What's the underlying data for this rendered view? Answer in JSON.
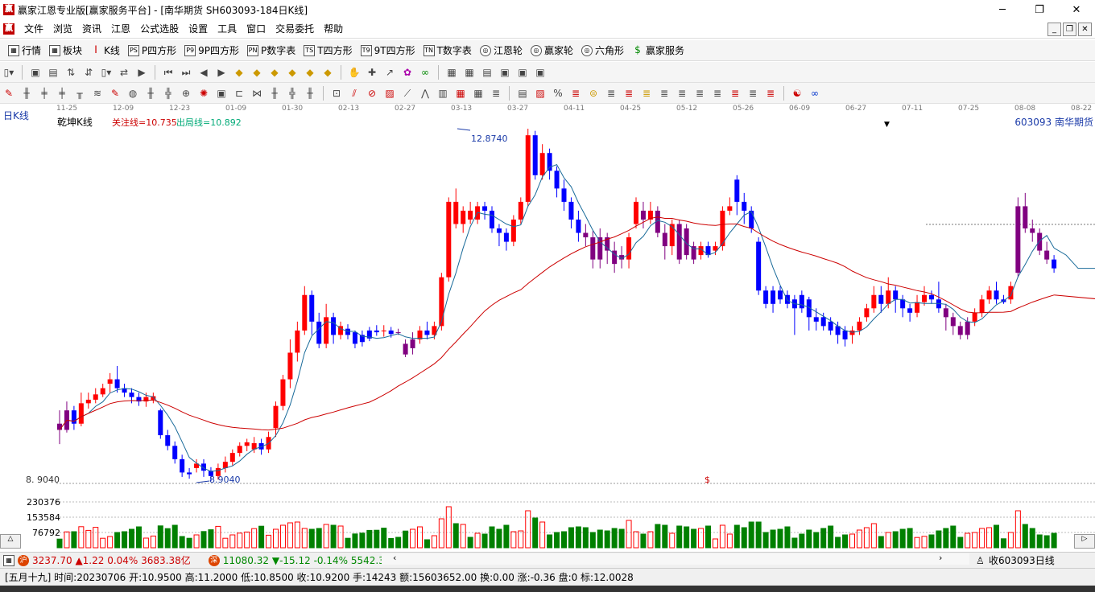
{
  "window": {
    "title": "赢家江恩专业版[赢家服务平台] - [南华期货   SH603093-184日K线]",
    "logo_char": "赢",
    "min": "─",
    "max": "❐",
    "close": "✕"
  },
  "menu": {
    "items": [
      "文件",
      "浏览",
      "资讯",
      "江恩",
      "公式选股",
      "设置",
      "工具",
      "窗口",
      "交易委托",
      "帮助"
    ]
  },
  "toolbar1": {
    "items": [
      {
        "icon": "▦",
        "label": "行情"
      },
      {
        "icon": "▦",
        "label": "板块"
      },
      {
        "icon": "┃",
        "label": "K线"
      },
      {
        "icon": "PS",
        "label": "P四方形"
      },
      {
        "icon": "P9",
        "label": "9P四方形"
      },
      {
        "icon": "PN",
        "label": "P数字表"
      },
      {
        "icon": "TS",
        "label": "T四方形"
      },
      {
        "icon": "T9",
        "label": "9T四方形"
      },
      {
        "icon": "TN",
        "label": "T数字表"
      },
      {
        "icon": "◎",
        "label": "江恩轮"
      },
      {
        "icon": "◎",
        "label": "赢家轮"
      },
      {
        "icon": "◎",
        "label": "六角形"
      },
      {
        "icon": "$",
        "label": "赢家服务"
      }
    ]
  },
  "chart": {
    "period_label": "日K线",
    "indicator_name": "乾坤K线",
    "focus_line": "关注线=10.735",
    "exit_line": "出局线=10.892",
    "stock": "603093  南华期货",
    "high_label": "12.8740",
    "low_label": "8.9040",
    "low_axis": "8. 9040",
    "dollar": "$",
    "dates": [
      "11-25",
      "12-09",
      "12-23",
      "01-09",
      "01-30",
      "02-13",
      "02-27",
      "03-13",
      "03-27",
      "04-11",
      "04-25",
      "05-12",
      "05-26",
      "06-09",
      "06-27",
      "07-11",
      "07-25",
      "08-08",
      "08-22"
    ],
    "vol_ticks": [
      "230376",
      "153584",
      "76792"
    ]
  },
  "colors": {
    "up": "#ff0000",
    "down": "#0000ff",
    "neutral": "#800080",
    "ma_short": "#1a6b9a",
    "ma_long": "#cc0000",
    "vol_up": "#ff0000",
    "vol_down": "#008000"
  },
  "chart_data": {
    "type": "candlestick",
    "y_range": [
      8.904,
      12.874
    ],
    "candles": [
      {
        "o": 9.55,
        "c": 9.48,
        "h": 9.7,
        "l": 9.32
      },
      {
        "o": 9.48,
        "c": 9.7,
        "h": 9.8,
        "l": 9.45
      },
      {
        "o": 9.7,
        "c": 9.55,
        "h": 9.75,
        "l": 9.48
      },
      {
        "o": 9.55,
        "c": 9.78,
        "h": 9.9,
        "l": 9.52
      },
      {
        "o": 9.78,
        "c": 9.82,
        "h": 9.9,
        "l": 9.72
      },
      {
        "o": 9.82,
        "c": 9.88,
        "h": 9.95,
        "l": 9.78
      },
      {
        "o": 9.88,
        "c": 9.95,
        "h": 10.0,
        "l": 9.85
      },
      {
        "o": 10.0,
        "c": 10.05,
        "h": 10.12,
        "l": 9.9
      },
      {
        "o": 10.05,
        "c": 9.95,
        "h": 10.2,
        "l": 9.9
      },
      {
        "o": 9.95,
        "c": 9.9,
        "h": 10.0,
        "l": 9.85
      },
      {
        "o": 9.9,
        "c": 9.85,
        "h": 9.95,
        "l": 9.78
      },
      {
        "o": 9.85,
        "c": 9.8,
        "h": 9.9,
        "l": 9.75
      },
      {
        "o": 9.8,
        "c": 9.85,
        "h": 9.9,
        "l": 9.74
      },
      {
        "o": 9.82,
        "c": 9.86,
        "h": 9.9,
        "l": 9.78
      },
      {
        "o": 9.7,
        "c": 9.42,
        "h": 9.72,
        "l": 9.38
      },
      {
        "o": 9.42,
        "c": 9.3,
        "h": 9.48,
        "l": 9.25
      },
      {
        "o": 9.3,
        "c": 9.15,
        "h": 9.35,
        "l": 9.1
      },
      {
        "o": 9.15,
        "c": 9.0,
        "h": 9.2,
        "l": 8.95
      },
      {
        "o": 9.0,
        "c": 8.98,
        "h": 9.05,
        "l": 8.93
      },
      {
        "o": 9.05,
        "c": 9.1,
        "h": 9.15,
        "l": 9.0
      },
      {
        "o": 9.1,
        "c": 9.02,
        "h": 9.15,
        "l": 8.95
      },
      {
        "o": 9.02,
        "c": 8.96,
        "h": 9.06,
        "l": 8.904
      },
      {
        "o": 8.96,
        "c": 9.05,
        "h": 9.1,
        "l": 8.92
      },
      {
        "o": 9.05,
        "c": 9.12,
        "h": 9.18,
        "l": 9.0
      },
      {
        "o": 9.12,
        "c": 9.22,
        "h": 9.26,
        "l": 9.08
      },
      {
        "o": 9.22,
        "c": 9.3,
        "h": 9.34,
        "l": 9.18
      },
      {
        "o": 9.3,
        "c": 9.34,
        "h": 9.38,
        "l": 9.24
      },
      {
        "o": 9.26,
        "c": 9.33,
        "h": 9.4,
        "l": 9.22
      },
      {
        "o": 9.33,
        "c": 9.26,
        "h": 9.38,
        "l": 9.2
      },
      {
        "o": 9.26,
        "c": 9.4,
        "h": 9.46,
        "l": 9.22
      },
      {
        "o": 9.5,
        "c": 9.75,
        "h": 9.8,
        "l": 9.4
      },
      {
        "o": 9.75,
        "c": 10.05,
        "h": 10.1,
        "l": 9.7
      },
      {
        "o": 10.05,
        "c": 10.35,
        "h": 10.5,
        "l": 9.95
      },
      {
        "o": 10.35,
        "c": 10.6,
        "h": 10.7,
        "l": 10.25
      },
      {
        "o": 10.6,
        "c": 11.0,
        "h": 11.1,
        "l": 10.55
      },
      {
        "o": 11.0,
        "c": 10.7,
        "h": 11.05,
        "l": 10.55
      },
      {
        "o": 10.7,
        "c": 10.45,
        "h": 10.8,
        "l": 10.4
      },
      {
        "o": 10.45,
        "c": 10.75,
        "h": 10.9,
        "l": 10.4
      },
      {
        "o": 10.75,
        "c": 10.55,
        "h": 10.8,
        "l": 10.45
      },
      {
        "o": 10.55,
        "c": 10.65,
        "h": 10.7,
        "l": 10.5
      },
      {
        "o": 10.62,
        "c": 10.55,
        "h": 10.67,
        "l": 10.5
      },
      {
        "o": 10.58,
        "c": 10.45,
        "h": 10.6,
        "l": 10.4
      },
      {
        "o": 10.55,
        "c": 10.47,
        "h": 10.6,
        "l": 10.42
      },
      {
        "o": 10.6,
        "c": 10.51,
        "h": 10.64,
        "l": 10.48
      },
      {
        "o": 10.6,
        "c": 10.58,
        "h": 10.66,
        "l": 10.54
      },
      {
        "o": 10.6,
        "c": 10.59,
        "h": 10.66,
        "l": 10.53
      },
      {
        "o": 10.6,
        "c": 10.56,
        "h": 10.64,
        "l": 10.52
      },
      {
        "o": 10.58,
        "c": 10.58,
        "h": 10.62,
        "l": 10.55
      },
      {
        "o": 10.45,
        "c": 10.33,
        "h": 10.5,
        "l": 10.3
      },
      {
        "o": 10.4,
        "c": 10.5,
        "h": 10.58,
        "l": 10.33
      },
      {
        "o": 10.5,
        "c": 10.6,
        "h": 10.65,
        "l": 10.45
      },
      {
        "o": 10.6,
        "c": 10.55,
        "h": 10.7,
        "l": 10.5
      },
      {
        "o": 10.55,
        "c": 10.65,
        "h": 10.7,
        "l": 10.5
      },
      {
        "o": 10.65,
        "c": 11.2,
        "h": 11.25,
        "l": 10.6
      },
      {
        "o": 11.2,
        "c": 12.05,
        "h": 12.1,
        "l": 11.15
      },
      {
        "o": 12.05,
        "c": 11.8,
        "h": 12.2,
        "l": 11.75
      },
      {
        "o": 11.8,
        "c": 11.95,
        "h": 12.0,
        "l": 11.7
      },
      {
        "o": 11.95,
        "c": 11.85,
        "h": 12.05,
        "l": 11.8
      },
      {
        "o": 11.85,
        "c": 12.0,
        "h": 12.05,
        "l": 11.8
      },
      {
        "o": 12.0,
        "c": 11.95,
        "h": 12.05,
        "l": 11.85
      },
      {
        "o": 11.95,
        "c": 11.75,
        "h": 12.0,
        "l": 11.7
      },
      {
        "o": 11.75,
        "c": 11.7,
        "h": 11.8,
        "l": 11.55
      },
      {
        "o": 11.7,
        "c": 11.6,
        "h": 11.75,
        "l": 11.5
      },
      {
        "o": 11.6,
        "c": 11.85,
        "h": 11.9,
        "l": 11.55
      },
      {
        "o": 11.85,
        "c": 12.05,
        "h": 12.1,
        "l": 11.8
      },
      {
        "o": 12.05,
        "c": 12.8,
        "h": 12.874,
        "l": 12.0
      },
      {
        "o": 12.8,
        "c": 12.35,
        "h": 12.85,
        "l": 12.3
      },
      {
        "o": 12.35,
        "c": 12.6,
        "h": 12.7,
        "l": 12.3
      },
      {
        "o": 12.6,
        "c": 12.4,
        "h": 12.65,
        "l": 12.3
      },
      {
        "o": 12.4,
        "c": 12.2,
        "h": 12.45,
        "l": 12.1
      },
      {
        "o": 12.2,
        "c": 12.05,
        "h": 12.3,
        "l": 11.95
      },
      {
        "o": 12.05,
        "c": 11.85,
        "h": 12.1,
        "l": 11.75
      },
      {
        "o": 11.85,
        "c": 11.7,
        "h": 11.95,
        "l": 11.6
      },
      {
        "o": 11.7,
        "c": 11.65,
        "h": 11.8,
        "l": 11.55
      },
      {
        "o": 11.65,
        "c": 11.4,
        "h": 11.72,
        "l": 11.3
      },
      {
        "o": 11.65,
        "c": 11.4,
        "h": 11.75,
        "l": 11.3
      },
      {
        "o": 11.65,
        "c": 11.5,
        "h": 11.7,
        "l": 11.35
      },
      {
        "o": 11.5,
        "c": 11.35,
        "h": 11.6,
        "l": 11.25
      },
      {
        "o": 11.45,
        "c": 11.4,
        "h": 11.55,
        "l": 11.3
      },
      {
        "o": 11.4,
        "c": 11.65,
        "h": 11.7,
        "l": 11.3
      },
      {
        "o": 11.8,
        "c": 12.05,
        "h": 12.1,
        "l": 11.75
      },
      {
        "o": 11.95,
        "c": 11.85,
        "h": 12.05,
        "l": 11.75
      },
      {
        "o": 11.85,
        "c": 11.95,
        "h": 12.05,
        "l": 11.8
      },
      {
        "o": 11.95,
        "c": 11.7,
        "h": 12.0,
        "l": 11.65
      },
      {
        "o": 11.7,
        "c": 11.55,
        "h": 11.8,
        "l": 11.4
      },
      {
        "o": 11.55,
        "c": 11.8,
        "h": 11.85,
        "l": 11.45
      },
      {
        "o": 11.8,
        "c": 11.4,
        "h": 11.85,
        "l": 11.35
      },
      {
        "o": 11.75,
        "c": 11.45,
        "h": 11.8,
        "l": 11.4
      },
      {
        "o": 11.55,
        "c": 11.4,
        "h": 11.6,
        "l": 11.35
      },
      {
        "o": 11.45,
        "c": 11.55,
        "h": 11.6,
        "l": 11.4
      },
      {
        "o": 11.55,
        "c": 11.45,
        "h": 11.6,
        "l": 11.42
      },
      {
        "o": 11.5,
        "c": 11.55,
        "h": 11.6,
        "l": 11.45
      },
      {
        "o": 11.55,
        "c": 11.95,
        "h": 12.0,
        "l": 11.5
      },
      {
        "o": 11.95,
        "c": 12.0,
        "h": 12.1,
        "l": 11.9
      },
      {
        "o": 12.3,
        "c": 12.05,
        "h": 12.35,
        "l": 11.9
      },
      {
        "o": 12.05,
        "c": 11.95,
        "h": 12.15,
        "l": 11.8
      },
      {
        "o": 11.95,
        "c": 11.75,
        "h": 12.0,
        "l": 11.7
      },
      {
        "o": 11.6,
        "c": 11.05,
        "h": 11.65,
        "l": 11.0
      },
      {
        "o": 11.05,
        "c": 10.9,
        "h": 11.1,
        "l": 10.85
      },
      {
        "o": 11.05,
        "c": 10.9,
        "h": 11.1,
        "l": 10.8
      },
      {
        "o": 11.05,
        "c": 10.95,
        "h": 11.1,
        "l": 10.9
      },
      {
        "o": 11.0,
        "c": 10.9,
        "h": 11.05,
        "l": 10.85
      },
      {
        "o": 10.95,
        "c": 10.85,
        "h": 11.0,
        "l": 10.55
      },
      {
        "o": 11.0,
        "c": 10.85,
        "h": 11.05,
        "l": 10.8
      },
      {
        "o": 10.95,
        "c": 10.75,
        "h": 10.98,
        "l": 10.6
      },
      {
        "o": 10.75,
        "c": 10.7,
        "h": 10.85,
        "l": 10.6
      },
      {
        "o": 10.75,
        "c": 10.65,
        "h": 10.8,
        "l": 10.6
      },
      {
        "o": 10.7,
        "c": 10.6,
        "h": 10.75,
        "l": 10.55
      },
      {
        "o": 10.65,
        "c": 10.55,
        "h": 10.7,
        "l": 10.45
      },
      {
        "o": 10.6,
        "c": 10.5,
        "h": 10.65,
        "l": 10.42
      },
      {
        "o": 10.55,
        "c": 10.6,
        "h": 10.65,
        "l": 10.45
      },
      {
        "o": 10.6,
        "c": 10.7,
        "h": 10.75,
        "l": 10.55
      },
      {
        "o": 10.75,
        "c": 10.85,
        "h": 10.9,
        "l": 10.7
      },
      {
        "o": 10.85,
        "c": 11.0,
        "h": 11.1,
        "l": 10.8
      },
      {
        "o": 11.0,
        "c": 10.9,
        "h": 11.1,
        "l": 10.8
      },
      {
        "o": 10.9,
        "c": 11.05,
        "h": 11.2,
        "l": 10.85
      },
      {
        "o": 11.05,
        "c": 10.95,
        "h": 11.1,
        "l": 10.8
      },
      {
        "o": 10.95,
        "c": 10.85,
        "h": 11.0,
        "l": 10.75
      },
      {
        "o": 10.85,
        "c": 10.8,
        "h": 10.9,
        "l": 10.7
      },
      {
        "o": 10.8,
        "c": 10.92,
        "h": 11.0,
        "l": 10.75
      },
      {
        "o": 10.92,
        "c": 11.0,
        "h": 11.1,
        "l": 10.88
      },
      {
        "o": 11.0,
        "c": 10.95,
        "h": 11.05,
        "l": 10.9
      },
      {
        "o": 10.95,
        "c": 10.85,
        "h": 11.15,
        "l": 10.8
      },
      {
        "o": 10.85,
        "c": 10.75,
        "h": 10.9,
        "l": 10.6
      },
      {
        "o": 10.75,
        "c": 10.65,
        "h": 10.8,
        "l": 10.55
      },
      {
        "o": 10.65,
        "c": 10.55,
        "h": 10.7,
        "l": 10.5
      },
      {
        "o": 10.55,
        "c": 10.7,
        "h": 10.75,
        "l": 10.5
      },
      {
        "o": 10.7,
        "c": 10.8,
        "h": 10.85,
        "l": 10.65
      },
      {
        "o": 10.8,
        "c": 10.95,
        "h": 11.0,
        "l": 10.75
      },
      {
        "o": 10.95,
        "c": 11.05,
        "h": 11.1,
        "l": 10.9
      },
      {
        "o": 11.05,
        "c": 10.95,
        "h": 11.15,
        "l": 10.9
      },
      {
        "o": 10.95,
        "c": 10.92,
        "h": 11.0,
        "l": 10.9
      },
      {
        "o": 10.95,
        "c": 11.1,
        "h": 11.15,
        "l": 10.9
      },
      {
        "o": 11.25,
        "c": 12.0,
        "h": 12.1,
        "l": 11.2
      },
      {
        "o": 12.0,
        "c": 11.75,
        "h": 12.15,
        "l": 11.7
      },
      {
        "o": 11.75,
        "c": 11.7,
        "h": 11.85,
        "l": 11.6
      },
      {
        "o": 11.7,
        "c": 11.5,
        "h": 11.75,
        "l": 11.45
      },
      {
        "o": 11.5,
        "c": 11.4,
        "h": 11.6,
        "l": 11.35
      },
      {
        "o": 11.4,
        "c": 11.3,
        "h": 11.45,
        "l": 11.25
      }
    ]
  }
}
